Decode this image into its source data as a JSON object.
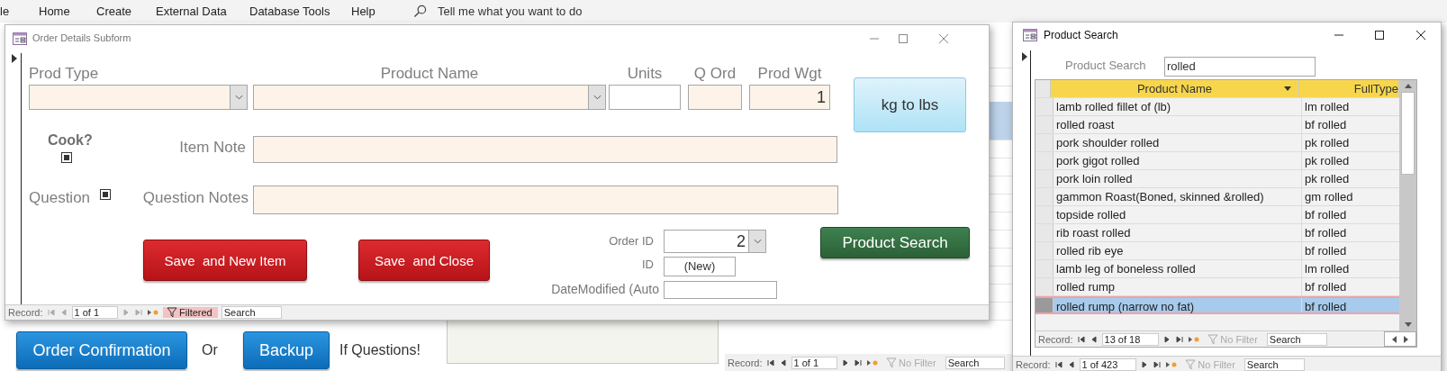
{
  "ribbon": {
    "tabs": [
      {
        "label": "le",
        "selected": false
      },
      {
        "label": "Home",
        "selected": false
      },
      {
        "label": "Create",
        "selected": false
      },
      {
        "label": "External Data",
        "selected": false
      },
      {
        "label": "Database Tools",
        "selected": false
      },
      {
        "label": "Help",
        "selected": false
      }
    ],
    "tell_me": "Tell me what you want to do"
  },
  "order_details": {
    "title": "Order Details Subform",
    "prod_type": {
      "label": "Prod Type"
    },
    "product_name": {
      "label": "Product Name"
    },
    "units": {
      "label": "Units"
    },
    "q_ord": {
      "label": "Q Ord"
    },
    "prod_wgt": {
      "label": "Prod Wgt",
      "value": "1"
    },
    "convert_button": "kg to lbs",
    "cook": {
      "label": "Cook?",
      "checked": true
    },
    "item_note": {
      "label": "Item Note"
    },
    "question": {
      "label": "Question",
      "checked": true
    },
    "question_notes": {
      "label": "Question Notes"
    },
    "save_new_button": "Save  and New Item",
    "save_close_button": "Save  and Close",
    "order_id": {
      "label": "Order ID",
      "value": "2"
    },
    "id": {
      "label": "ID",
      "value": "(New)"
    },
    "date_modified": {
      "label": "DateModified (Auto"
    },
    "search_button": "Product Search",
    "record_bar": {
      "label": "Record:",
      "position": "1 of 1",
      "filter": "Filtered",
      "filtered": true,
      "search": "Search"
    }
  },
  "product_search": {
    "title": "Product Search",
    "search_label": "Product Search",
    "search_value": "rolled",
    "columns": [
      "Product Name",
      "FullType"
    ],
    "rows": [
      {
        "name": "lamb rolled fillet of (lb)",
        "type": "lm rolled",
        "selected": false
      },
      {
        "name": "rolled roast",
        "type": "bf rolled",
        "selected": false
      },
      {
        "name": "pork shoulder rolled",
        "type": "pk rolled",
        "selected": false
      },
      {
        "name": "pork gigot rolled",
        "type": "pk rolled",
        "selected": false
      },
      {
        "name": "pork loin rolled",
        "type": "pk rolled",
        "selected": false
      },
      {
        "name": "gammon Roast(Boned, skinned &rolled)",
        "type": "gm rolled",
        "selected": false
      },
      {
        "name": "topside rolled",
        "type": "bf rolled",
        "selected": false
      },
      {
        "name": "rib roast rolled",
        "type": "bf rolled",
        "selected": false
      },
      {
        "name": "rolled rib eye",
        "type": "bf rolled",
        "selected": false
      },
      {
        "name": "lamb leg of boneless rolled",
        "type": "lm rolled",
        "selected": false
      },
      {
        "name": "rolled rump",
        "type": "bf rolled",
        "selected": false
      },
      {
        "name": "rolled rump (narrow no fat)",
        "type": "bf rolled",
        "selected": true
      }
    ],
    "datasheet_nav": {
      "label": "Record:",
      "position": "13 of 18",
      "filter": "No Filter",
      "filtered": false,
      "search": "Search"
    },
    "window_nav": {
      "label": "Record:",
      "position": "1 of 423",
      "filter": "No Filter",
      "filtered": false,
      "search": "Search"
    }
  },
  "background": {
    "confirm_button": "Order Confirmation",
    "or_text": "Or",
    "backup_button": "Backup",
    "questions_text": "If Questions!",
    "record_bar": {
      "label": "Record:",
      "position": "1 of 1",
      "filter": "No Filter",
      "filtered": false,
      "search": "Search"
    }
  }
}
